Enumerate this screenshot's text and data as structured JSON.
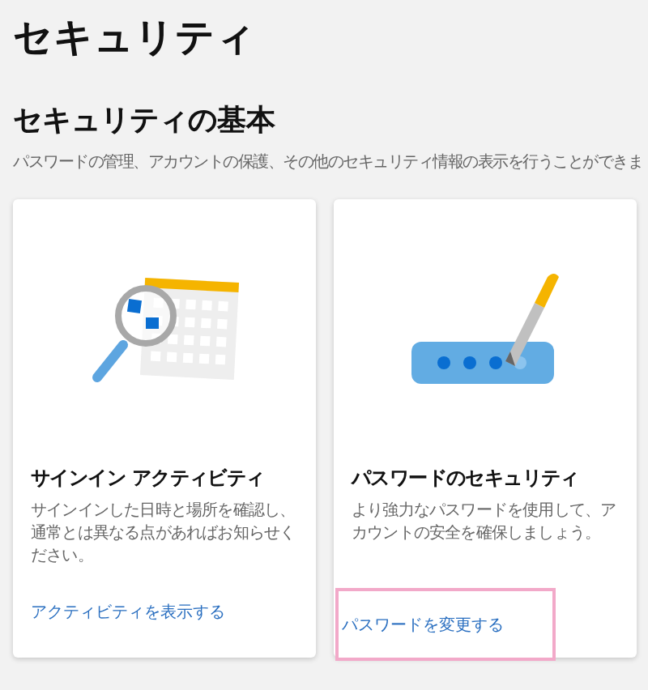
{
  "page_title": "セキュリティ",
  "section": {
    "heading": "セキュリティの基本",
    "description": "パスワードの管理、アカウントの保護、その他のセキュリティ情報の表示を行うことができま"
  },
  "cards": [
    {
      "kind": "activity",
      "title": "サインイン アクティビティ",
      "description": "サインインした日時と場所を確認し、通常とは異なる点があればお知らせください。",
      "link": "アクティビティを表示する",
      "highlighted": false
    },
    {
      "kind": "password",
      "title": "パスワードのセキュリティ",
      "description": "より強力なパスワードを使用して、アカウントの安全を確保しましょう。",
      "link": "パスワードを変更する",
      "highlighted": true
    }
  ]
}
